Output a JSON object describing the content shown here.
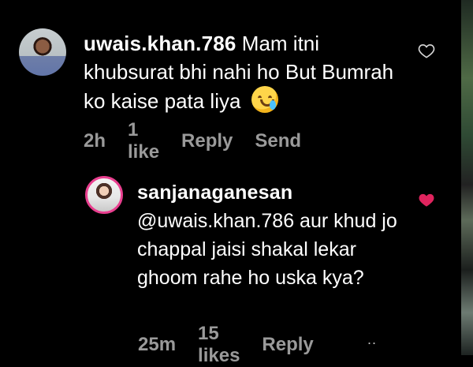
{
  "comments": [
    {
      "username": "uwais.khan.786",
      "text": "Mam itni khubsurat bhi nahi ho But Bumrah ko kaise pata liya",
      "time": "2h",
      "likes": "1 like",
      "reply": "Reply",
      "send": "Send",
      "emoji": "sad-emoji"
    },
    {
      "username": "sanjanaganesan",
      "text": "@uwais.khan.786 aur khud jo chappal jaisi shakal lekar ghoom rahe ho uska kya?",
      "time": "25m",
      "likes": "15 likes",
      "reply": "Reply",
      "more": ".."
    }
  ],
  "icons": {
    "like_outline": "heart-outline-icon",
    "like_filled": "heart-filled-icon",
    "more": "more-icon"
  },
  "colors": {
    "background": "#000000",
    "meta": "#9a9a9a",
    "liked": "#e0245e"
  }
}
